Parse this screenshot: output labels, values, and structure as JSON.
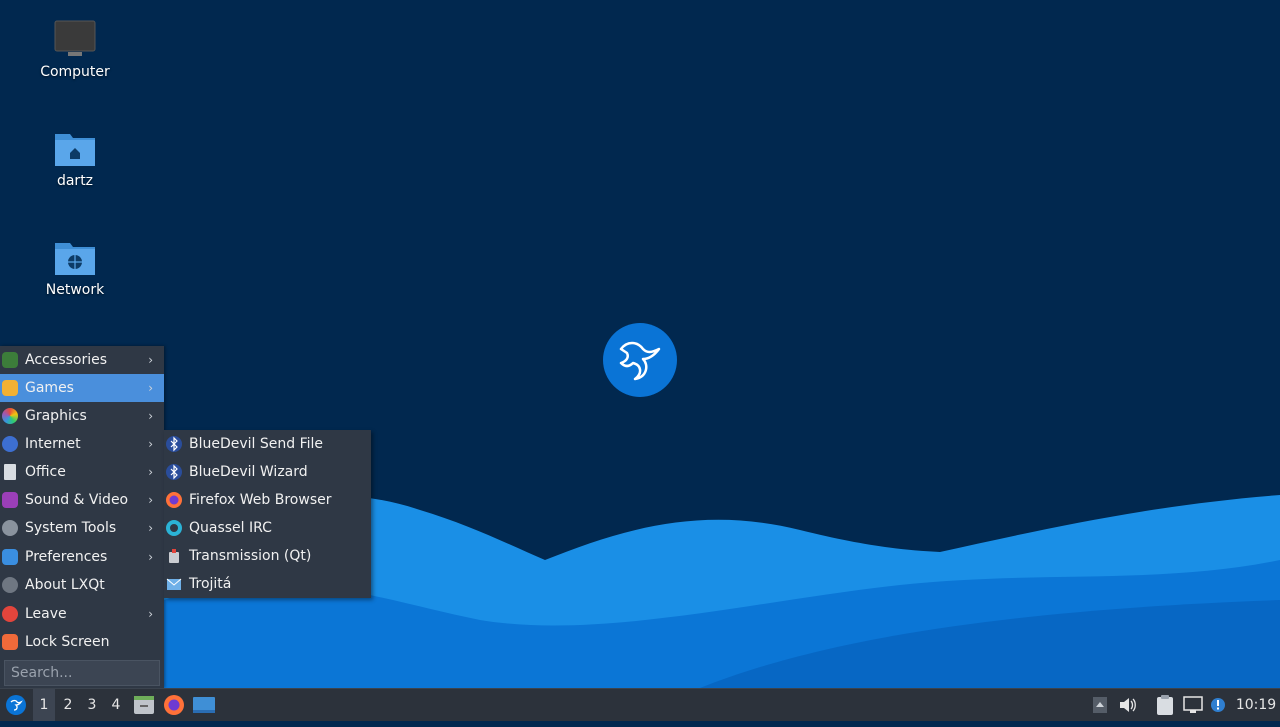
{
  "desktop": {
    "icons": [
      {
        "label": "Computer",
        "icon": "computer-icon"
      },
      {
        "label": "dartz",
        "icon": "home-folder-icon"
      },
      {
        "label": "Network",
        "icon": "network-folder-icon"
      }
    ]
  },
  "menu": {
    "items": [
      {
        "label": "Accessories",
        "icon": "accessories-icon",
        "submenu": true
      },
      {
        "label": "Games",
        "icon": "games-icon",
        "submenu": true,
        "active": true
      },
      {
        "label": "Graphics",
        "icon": "graphics-icon",
        "submenu": true
      },
      {
        "label": "Internet",
        "icon": "internet-icon",
        "submenu": true
      },
      {
        "label": "Office",
        "icon": "office-icon",
        "submenu": true
      },
      {
        "label": "Sound & Video",
        "icon": "sound-video-icon",
        "submenu": true
      },
      {
        "label": "System Tools",
        "icon": "system-tools-icon",
        "submenu": true
      },
      {
        "label": "Preferences",
        "icon": "preferences-icon",
        "submenu": true
      },
      {
        "label": "About LXQt",
        "icon": "info-icon",
        "submenu": false
      },
      {
        "label": "Leave",
        "icon": "power-icon",
        "submenu": true
      },
      {
        "label": "Lock Screen",
        "icon": "lock-icon",
        "submenu": false
      }
    ],
    "arrow": "›",
    "search_placeholder": "Search..."
  },
  "submenu": {
    "items": [
      {
        "label": "BlueDevil Send File",
        "icon": "bluetooth-icon"
      },
      {
        "label": "BlueDevil Wizard",
        "icon": "bluetooth-icon"
      },
      {
        "label": "Firefox Web Browser",
        "icon": "firefox-icon"
      },
      {
        "label": "Quassel IRC",
        "icon": "quassel-icon"
      },
      {
        "label": "Transmission (Qt)",
        "icon": "transmission-icon"
      },
      {
        "label": "Trojitá",
        "icon": "mail-icon"
      }
    ]
  },
  "taskbar": {
    "desktops": [
      "1",
      "2",
      "3",
      "4"
    ],
    "current_desktop": "1",
    "clock": "10:19"
  },
  "colors": {
    "wallpaper_dark": "#01284f",
    "wave_light": "#1e90e8",
    "wave_mid": "#0a7ad8",
    "menu_bg": "#2f3845",
    "menu_active": "#4a8fdc",
    "taskbar_bg": "#2c323b"
  }
}
